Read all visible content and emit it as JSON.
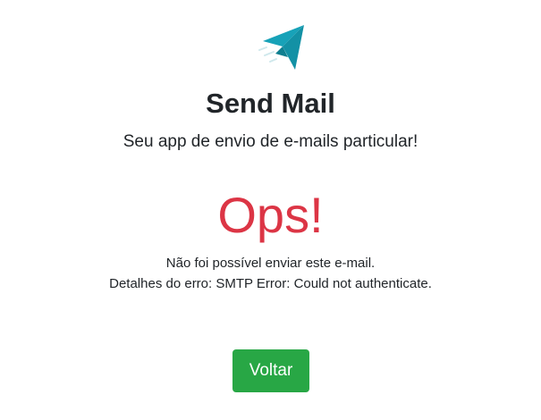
{
  "header": {
    "logo_icon": "paper-plane-icon",
    "logo_color": "#17a2b8",
    "title": "Send Mail",
    "subtitle": "Seu app de envio de e-mails particular!"
  },
  "error": {
    "heading": "Ops!",
    "heading_color": "#dc3545",
    "message": "Não foi possível enviar este e-mail.",
    "details": "Detalhes do erro: SMTP Error: Could not authenticate."
  },
  "actions": {
    "back_label": "Voltar",
    "back_color": "#28a745"
  }
}
